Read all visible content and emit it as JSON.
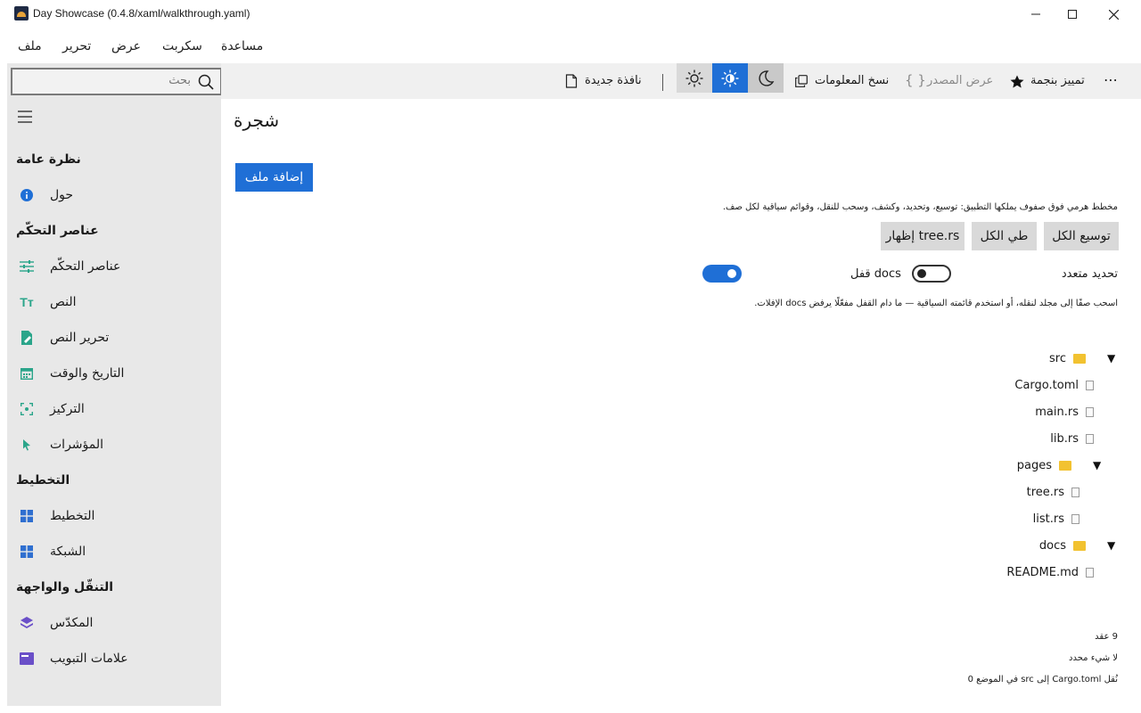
{
  "window": {
    "title": "Day Showcase (0.4.8/xaml/walkthrough.yaml)"
  },
  "menu": {
    "items": [
      "ملف",
      "تحرير",
      "عرض",
      "سكربت",
      "مساعدة"
    ]
  },
  "search": {
    "placeholder": "بحث"
  },
  "toolbar": {
    "more": "⋯",
    "star_label": "تمييز بنجمة",
    "view_source_label": "عرض المصدر",
    "copy_info_label": "نسخ المعلومات",
    "new_window_label": "نافذة جديدة"
  },
  "sidebar": {
    "sections": [
      {
        "heading": "نظرة عامة",
        "items": [
          {
            "label": "حول",
            "icon": "info-icon"
          }
        ]
      },
      {
        "heading": "عناصر التحكّم",
        "items": [
          {
            "label": "عناصر التحكّم",
            "icon": "sliders-icon"
          },
          {
            "label": "النص",
            "icon": "text-icon"
          },
          {
            "label": "تحرير النص",
            "icon": "edit-icon"
          },
          {
            "label": "التاريخ والوقت",
            "icon": "calendar-icon"
          },
          {
            "label": "التركيز",
            "icon": "focus-icon"
          },
          {
            "label": "المؤشرات",
            "icon": "pointer-icon"
          }
        ]
      },
      {
        "heading": "التخطيط",
        "items": [
          {
            "label": "التخطيط",
            "icon": "layout-icon"
          },
          {
            "label": "الشبكة",
            "icon": "grid-icon"
          }
        ]
      },
      {
        "heading": "التنقّل والواجهة",
        "items": [
          {
            "label": "المكدّس",
            "icon": "stack-icon"
          },
          {
            "label": "علامات التبويب",
            "icon": "tabs-icon"
          }
        ]
      }
    ]
  },
  "main": {
    "title": "شجرة",
    "add_file_button": "إضافة ملف",
    "description": "مخطط هرمي فوق صفوف يملكها التطبيق: توسيع، وتحديد، وكشف، وسحب للنقل، وقوائم سياقية لكل صف.",
    "buttons": {
      "expand_all": "توسيع الكل",
      "collapse_all": "طي الكل",
      "show_tree": "إظهار tree.rs"
    },
    "multi_select_label": "تحديد متعدد",
    "multi_select_on": true,
    "lock_docs_label": "قفل docs",
    "lock_docs_on": false,
    "hint": "اسحب صفًا إلى مجلد لنقله، أو استخدم قائمته السياقية — ما دام القفل مفعّلًا يرفض docs الإفلات.",
    "tree": [
      {
        "label": "src",
        "kind": "folder",
        "depth": 0,
        "expanded": true
      },
      {
        "label": "Cargo.toml",
        "kind": "file",
        "depth": 1
      },
      {
        "label": "main.rs",
        "kind": "file",
        "depth": 1
      },
      {
        "label": "lib.rs",
        "kind": "file",
        "depth": 1
      },
      {
        "label": "pages",
        "kind": "folder",
        "depth": 1,
        "expanded": true
      },
      {
        "label": "tree.rs",
        "kind": "file",
        "depth": 2
      },
      {
        "label": "list.rs",
        "kind": "file",
        "depth": 2
      },
      {
        "label": "docs",
        "kind": "folder",
        "depth": 0,
        "expanded": true
      },
      {
        "label": "README.md",
        "kind": "file",
        "depth": 1
      }
    ],
    "status": {
      "node_count": "9 عقد",
      "selection": "لا شيء محدد",
      "last_move": "نُقل Cargo.toml إلى src في الموضع 0"
    }
  },
  "colors": {
    "accent": "#1f6fd6",
    "sidebar_bg": "#e8e8e8",
    "toolbar_bg": "#f0f0f0",
    "folder": "#f2c230"
  }
}
